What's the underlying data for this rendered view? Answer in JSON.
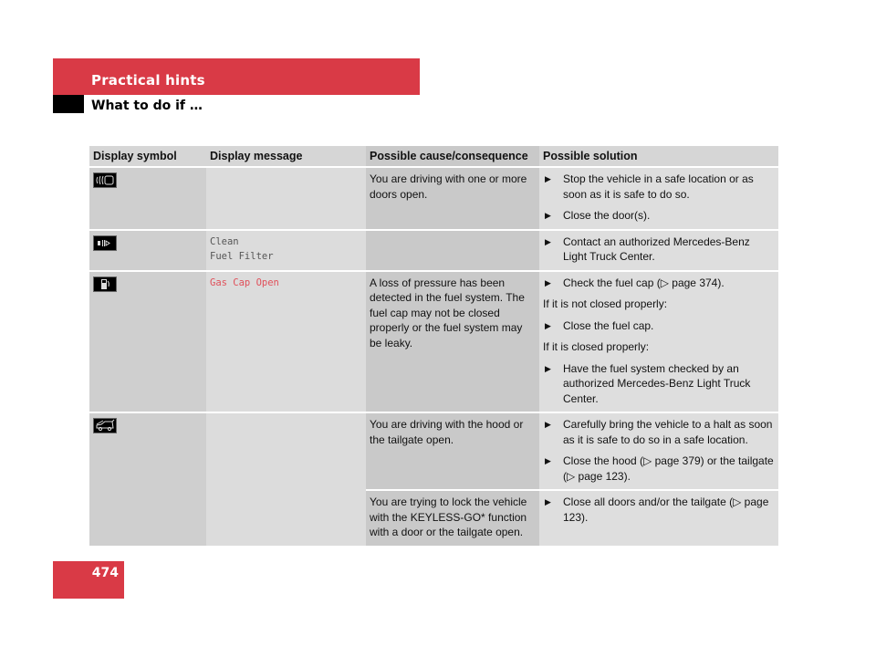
{
  "header": {
    "section": "Practical hints",
    "subsection": "What to do if …"
  },
  "page_number": "474",
  "brand_color": "#d93a46",
  "table": {
    "columns": [
      "Display symbol",
      "Display message",
      "Possible cause/consequence",
      "Possible solution"
    ],
    "rows": [
      {
        "icon": "door-open-icon",
        "message": "",
        "cause": "You are driving with one or more doors open.",
        "solution": [
          {
            "type": "bullet",
            "text": "Stop the vehicle in a safe location or as soon as it is safe to do so."
          },
          {
            "type": "bullet",
            "text": "Close the door(s)."
          }
        ]
      },
      {
        "icon": "fuel-filter-icon",
        "message_line1": "Clean",
        "message_line2": "Fuel Filter",
        "cause": "",
        "solution": [
          {
            "type": "bullet",
            "text": "Contact an authorized Mercedes-Benz Light Truck Center."
          }
        ]
      },
      {
        "icon": "fuel-pump-icon",
        "message": "Gas Cap Open",
        "cause": "A loss of pressure has been detected in the fuel system. The fuel cap may not be closed properly or the fuel system may be leaky.",
        "solution": [
          {
            "type": "bullet",
            "text": "Check the fuel cap (▷ page 374)."
          },
          {
            "type": "plain",
            "text": "If it is not closed properly:"
          },
          {
            "type": "bullet",
            "text": "Close the fuel cap."
          },
          {
            "type": "plain",
            "text": "If it is closed properly:"
          },
          {
            "type": "bullet",
            "text": "Have the fuel system checked by an authorized Mercedes-Benz Light Truck Center."
          }
        ]
      },
      {
        "icon": "hood-tailgate-open-icon",
        "message": "",
        "cause": "You are driving with the hood or the tailgate open.",
        "solution": [
          {
            "type": "bullet",
            "text": "Carefully bring the vehicle to a halt as soon as it is safe to do so in a safe location."
          },
          {
            "type": "bullet",
            "text": "Close the hood (▷ page 379) or the tailgate (▷ page 123)."
          }
        ],
        "cause2": "You are trying to lock the vehicle with the KEYLESS-GO* function with a door or the tailgate open.",
        "solution2": [
          {
            "type": "bullet",
            "text": "Close all doors and/or the tailgate (▷ page 123)."
          }
        ]
      }
    ]
  }
}
